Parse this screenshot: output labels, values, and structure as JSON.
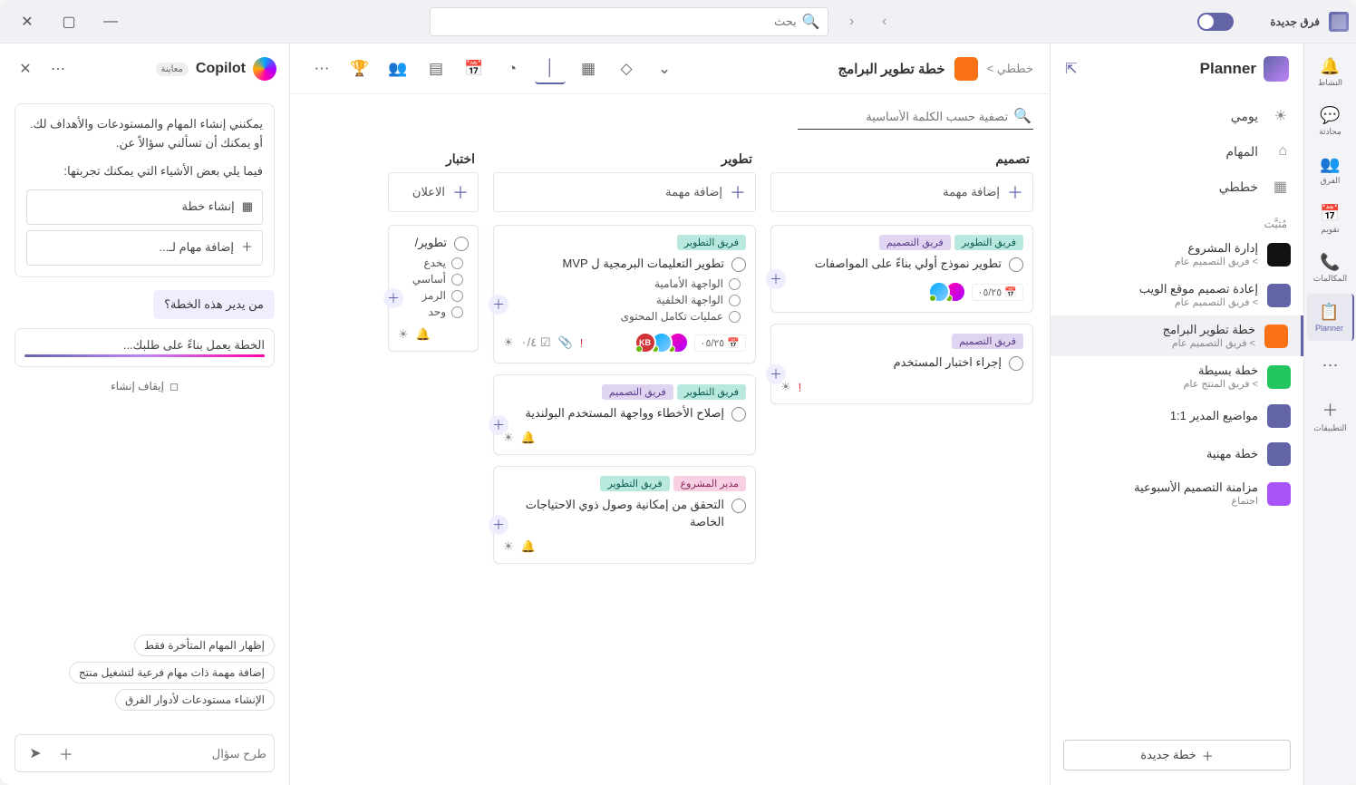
{
  "titlebar": {
    "appName": "فرق جديدة",
    "searchPlaceholder": "بحث"
  },
  "rail": {
    "items": [
      {
        "icon": "🔔",
        "label": "النشاط"
      },
      {
        "icon": "💬",
        "label": "محادثة"
      },
      {
        "icon": "👥",
        "label": "الفرق"
      },
      {
        "icon": "📅",
        "label": "تقويم"
      },
      {
        "icon": "📞",
        "label": "المكالمات"
      },
      {
        "icon": "📋",
        "label": "Planner",
        "active": true
      },
      {
        "icon": "⋯",
        "label": ""
      },
      {
        "icon": "＋",
        "label": "التطبيقات"
      }
    ]
  },
  "leftpanel": {
    "title": "Planner",
    "nav": [
      {
        "icon": "☀",
        "label": "يومي"
      },
      {
        "icon": "⌂",
        "label": "المهام"
      },
      {
        "icon": "▦",
        "label": "خططي"
      }
    ],
    "section": "مُثبَّت",
    "plans": [
      {
        "name": "إدارة المشروع",
        "sub": "&gt; فريق التصميم   عام",
        "color": "#111"
      },
      {
        "name": "إعادة تصميم موقع الويب",
        "sub": "&gt; فريق التصميم   عام",
        "color": "#6264a7"
      },
      {
        "name": "خطة تطوير البرامج",
        "sub": "&gt; فريق التصميم   عام",
        "color": "#f97316",
        "active": true
      },
      {
        "name": "خطة بسيطة",
        "sub": "&gt; فريق المنتج   عام",
        "color": "#22c55e"
      },
      {
        "name": "مواضيع المدير 1:1",
        "sub": "",
        "color": "#6264a7"
      },
      {
        "name": "خطة مهنية",
        "sub": "",
        "color": "#6264a7"
      },
      {
        "name": "مزامنة التصميم الأسبوعية",
        "sub": "اجتماع",
        "color": "#a855f7"
      }
    ],
    "newPlan": "خطة جديدة"
  },
  "main": {
    "crumb": "خططي &gt;",
    "title": "خطة تطوير البرامج",
    "filterPlaceholder": "تصفية حسب الكلمة الأساسية",
    "buckets": [
      {
        "name": "تصميم",
        "addLabel": "إضافة مهمة",
        "cards": [
          {
            "tags": [
              {
                "text": "فريق التطوير",
                "cls": "teal"
              },
              {
                "text": "فريق التصميم",
                "cls": "purple"
              }
            ],
            "title": "تطوير نموذج أولي بناءً على المواصفات",
            "date": "٠٥/٢٥",
            "avatars": [
              "a1",
              "a2"
            ]
          },
          {
            "tags": [
              {
                "text": "فريق التصميم",
                "cls": "purple"
              }
            ],
            "title": "إجراء اختبار المستخدم",
            "footerIcons": [
              "urgent",
              "sun"
            ]
          }
        ]
      },
      {
        "name": "تطوير",
        "addLabel": "إضافة مهمة",
        "cards": [
          {
            "tags": [
              {
                "text": "فريق التطوير",
                "cls": "teal"
              }
            ],
            "title": "تطوير التعليمات البرمجية ل MVP",
            "subtasks": [
              "الواجهة الأمامية",
              "الواجهة الخلفية",
              "عمليات تكامل المحتوى"
            ],
            "meta": "٠/٤",
            "date": "٠٥/٢٥",
            "avatars": [
              "a1",
              "a2",
              "kb"
            ],
            "footerIcons": [
              "urgent",
              "attach",
              "check",
              "sun"
            ]
          },
          {
            "tags": [
              {
                "text": "فريق التطوير",
                "cls": "teal"
              },
              {
                "text": "فريق التصميم",
                "cls": "purple"
              }
            ],
            "title": "إصلاح الأخطاء وواجهة المستخدم البولندية",
            "footerIcons": [
              "bell",
              "sun"
            ]
          },
          {
            "tags": [
              {
                "text": "مدير المشروع",
                "cls": "pink"
              },
              {
                "text": "فريق التطوير",
                "cls": "teal"
              }
            ],
            "title": "التحقق من إمكانية وصول ذوي الاحتياجات الخاصة",
            "footerIcons": [
              "bell",
              "sun"
            ]
          }
        ]
      },
      {
        "name": "اختبار",
        "addLabel": "الاعلان",
        "narrow": true,
        "cards": [
          {
            "title": "تطوير/",
            "subtasks": [
              "يخدع",
              "أساسي",
              "الرمز",
              "وحد"
            ],
            "footerIcons": [
              "bell",
              "sun"
            ]
          }
        ]
      }
    ]
  },
  "copilot": {
    "title": "Copilot",
    "badge": "معاينة",
    "intro1": "يمكنني إنشاء المهام والمستودعات والأهداف لك. أو يمكنك أن تسألني سؤالاً عن.",
    "intro2": "فيما يلي بعض الأشياء التي يمكنك تجربتها:",
    "opts": [
      {
        "icon": "▦",
        "label": "إنشاء خطة"
      },
      {
        "icon": "＋",
        "label": "إضافة مهام لـ..."
      }
    ],
    "userMsg": "من يدير هذه الخطة؟",
    "resp": "الخطة يعمل بناءً على طلبك...",
    "stop": "إيقاف إنشاء",
    "suggestions": [
      "إظهار المهام المتأخرة فقط",
      "إضافة مهمة ذات مهام فرعية لتشغيل منتج",
      "الإنشاء مستودعات لأدوار الفرق"
    ],
    "inputPlaceholder": "طرح سؤال"
  }
}
